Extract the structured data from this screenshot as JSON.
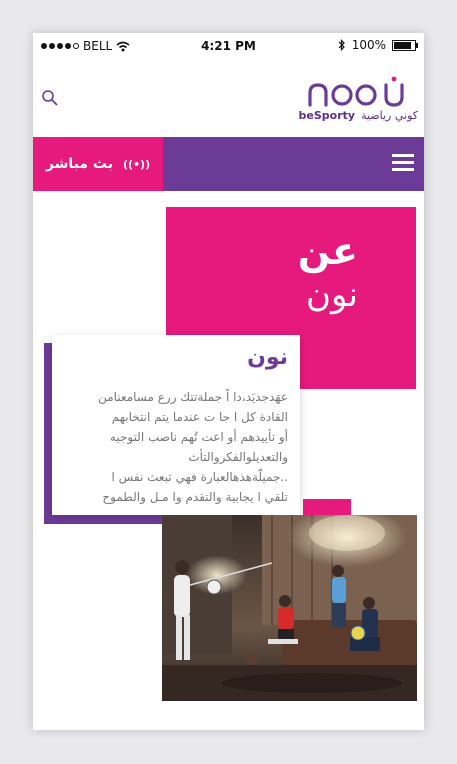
{
  "status_bar": {
    "carrier": "BELL",
    "time": "4:21 PM",
    "battery": "100%"
  },
  "header": {
    "logo_tagline_ar": "كوني رياضية",
    "logo_tagline_en": "beSporty"
  },
  "nav": {
    "live_label": "بث مباشر"
  },
  "hero": {
    "line1": "عن",
    "line2": "نون"
  },
  "card": {
    "title": "نون",
    "lines": [
      "عهَدجديَد،دا اً جملةتتك ررع مسامعنامن",
      "القادة   كل ا جا ت عندما يتم انتخابهم",
      "أو تأييدهم أو اعت تُهم  ناصب التوجيه",
      "والتعديلوالفكروالتأث",
      "..جميلّةهذهالعبارة فهي تبعث   نفس ا",
      "تلقي ا يجابية والتقدم وا مـل والطموح"
    ]
  },
  "colors": {
    "purple": "#6c3b97",
    "pink": "#e6197c"
  },
  "icons": [
    "search-icon",
    "hamburger-menu-icon",
    "live-broadcast-icon",
    "wifi-icon",
    "bluetooth-icon",
    "battery-icon"
  ]
}
